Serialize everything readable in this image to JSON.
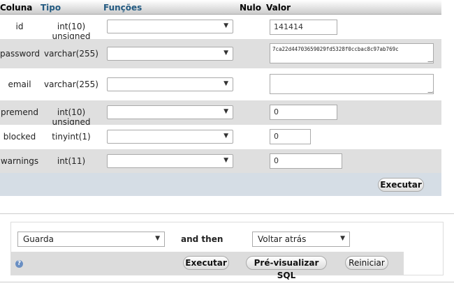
{
  "header": {
    "col_column": "Coluna",
    "col_type": "Tipo",
    "col_functions": "Funções",
    "col_null": "Nulo",
    "col_value": "Valor"
  },
  "rows": [
    {
      "name": "id",
      "type": "int(10) unsigned",
      "function": "",
      "value": "141414"
    },
    {
      "name": "password",
      "type": "varchar(255)",
      "function": "",
      "value": "7ca22d44703659029fd5328f0ccbac8c97ab769c"
    },
    {
      "name": "email",
      "type": "varchar(255)",
      "function": "",
      "value": ""
    },
    {
      "name": "premend",
      "type": "int(10) unsigned",
      "function": "",
      "value": "0"
    },
    {
      "name": "blocked",
      "type": "tinyint(1)",
      "function": "",
      "value": "0"
    },
    {
      "name": "warnings",
      "type": "int(11)",
      "function": "",
      "value": "0"
    }
  ],
  "execute_label": "Executar",
  "bottom": {
    "action_select": "Guarda",
    "and_then": "and then",
    "after_select": "Voltar atrás",
    "execute_label": "Executar",
    "preview_label": "Pré-visualizar SQL",
    "reset_label": "Reiniciar",
    "help_icon": "?"
  },
  "colors": {
    "header_link": "#235a81",
    "row_alt": "#dfdfdf",
    "footer_bar": "#d5dde5"
  },
  "icons": {
    "dropdown": "chevron-down-icon",
    "help": "help-icon"
  }
}
